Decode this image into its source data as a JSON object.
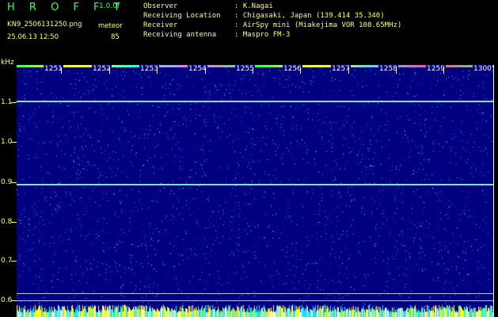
{
  "header": {
    "logo": "H R O F F T",
    "version": "1.0.0f",
    "filename": "KN9_2506131250.png",
    "unit_label": "meteor",
    "timestamp": "25.06.13 12:50",
    "value": "85",
    "info": [
      {
        "key": "Observer",
        "value": ": K.Nagai"
      },
      {
        "key": "Receiving Location",
        "value": ": Chigasaki, Japan (139.414 35.340)"
      },
      {
        "key": "Receiver",
        "value": ": AirSpy mini (Miakejima VOR 108.65MHz)"
      },
      {
        "key": "Receiving antenna",
        "value": ": Maspro FM-3"
      }
    ]
  },
  "axis": {
    "y_unit": "kHz",
    "y_labels": [
      "1.1",
      "1.0",
      "0.9",
      "0.8",
      "0.7",
      "0.6"
    ],
    "x_labels": [
      "1251",
      "1252",
      "1253",
      "1254",
      "1255",
      "1256",
      "1257",
      "1258",
      "1259",
      "1300"
    ]
  },
  "colors": {
    "background": "#000000",
    "plot": "#000080",
    "header_text": "#ffff66",
    "logo": "#33ff66"
  }
}
